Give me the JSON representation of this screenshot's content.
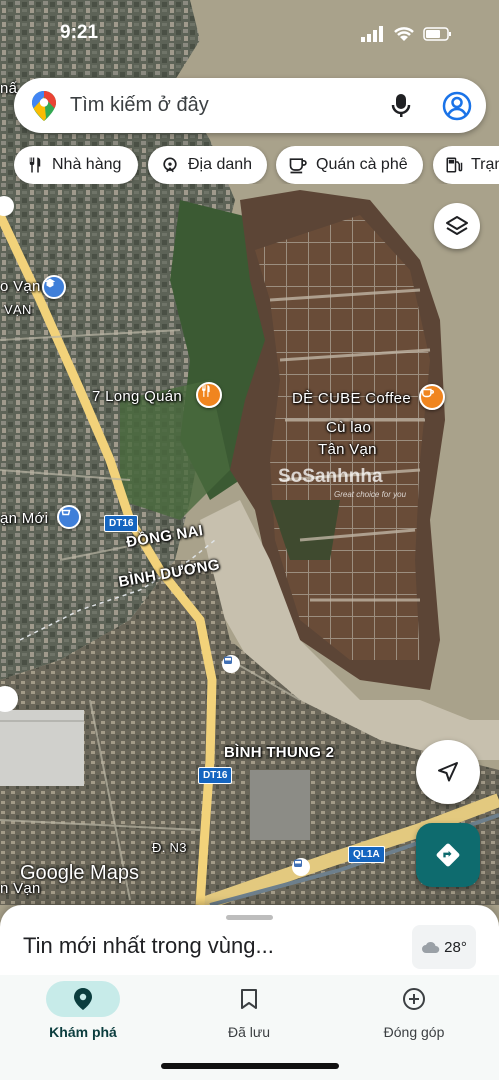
{
  "status_bar": {
    "time": "9:21"
  },
  "search": {
    "placeholder": "Tìm kiếm ở đây"
  },
  "chips": [
    {
      "label": "Nhà hàng",
      "icon": "restaurant-icon"
    },
    {
      "label": "Địa danh",
      "icon": "landmark-icon"
    },
    {
      "label": "Quán cà phê",
      "icon": "coffee-icon"
    },
    {
      "label": "Trạm",
      "icon": "gas-station-icon"
    }
  ],
  "map": {
    "labels": {
      "poi_restaurant": "7 Long Quán",
      "poi_coffee": "DÈ CUBE Coffee",
      "island_line1": "Cù lao",
      "island_line2": "Tân Vạn",
      "province_1": "ĐỒNG NAI",
      "province_2": "BÌNH DƯƠNG",
      "area_1": "BÌNH THUNG 2",
      "road_dt16_a": "DT16",
      "road_dt16_b": "DT16",
      "road_ql1a": "QL1A",
      "road_n3": "Đ. N3",
      "left_van": "o Vạn",
      "left_van_2": "VẠN",
      "left_van_moi": "ạn Mới",
      "left_van_3": "n Vạn",
      "left_nam": "nấ"
    },
    "watermark": "SoSanhnha",
    "watermark_sub": "Great choice for you",
    "attribution": "Google Maps"
  },
  "sheet": {
    "title": "Tin mới nhất trong vùng...",
    "weather": "28°"
  },
  "nav": [
    {
      "label": "Khám phá",
      "active": true
    },
    {
      "label": "Đã lưu",
      "active": false
    },
    {
      "label": "Đóng góp",
      "active": false
    }
  ],
  "colors": {
    "accent": "#0e6b6e",
    "nav_active_pill": "#c7ebe9",
    "road_yellow": "#f2d27a",
    "road_shield": "#1565c0"
  }
}
